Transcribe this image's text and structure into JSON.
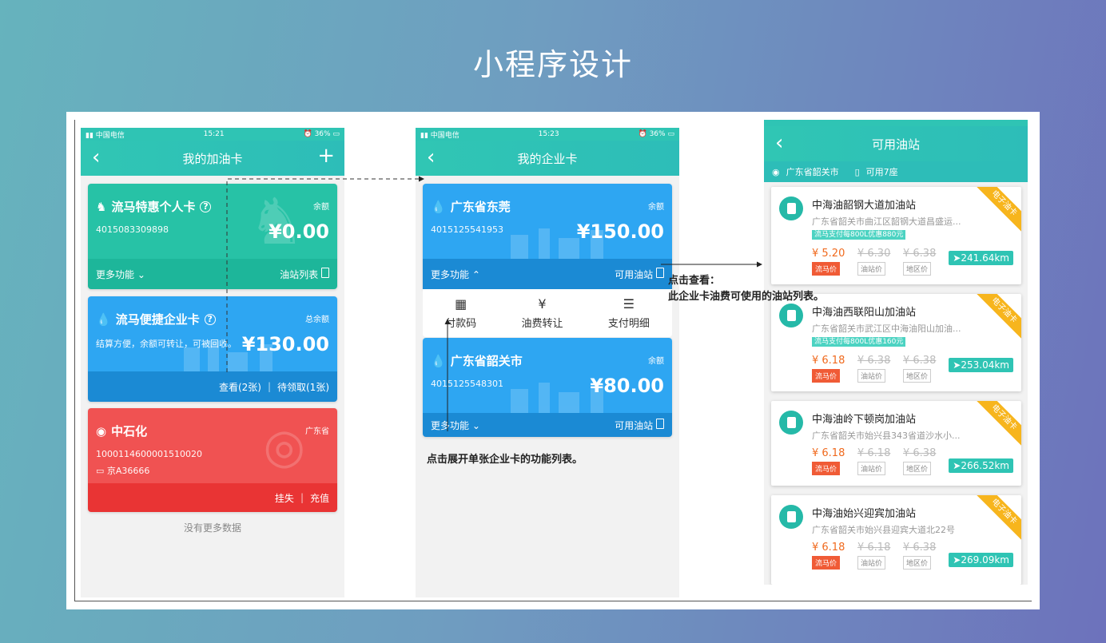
{
  "hero": {
    "title": "小程序设计"
  },
  "screen1": {
    "status": {
      "carrier": "中国电信",
      "time": "15:21",
      "battery": "36%"
    },
    "title": "我的加油卡",
    "cards": [
      {
        "name": "流马特惠个人卡",
        "number": "4015083309898",
        "balance_label": "余额",
        "balance": "¥0.00",
        "left": "更多功能",
        "right": "油站列表"
      },
      {
        "name": "流马便捷企业卡",
        "subtitle": "结算方便，余额可转让，可被回收。",
        "balance_label": "总余额",
        "balance": "¥130.00",
        "link1": "查看(2张)",
        "link2": "待领取(1张)"
      },
      {
        "name": "中石化",
        "number": "1000114600001510020",
        "plate": "京A36666",
        "region": "广东省",
        "action1": "挂失",
        "action2": "充值"
      }
    ],
    "footer": "没有更多数据"
  },
  "screen2": {
    "status": {
      "carrier": "中国电信",
      "time": "15:23",
      "battery": "36%"
    },
    "title": "我的企业卡",
    "cards": [
      {
        "name": "广东省东莞",
        "number": "4015125541953",
        "balance_label": "余额",
        "balance": "¥150.00",
        "left": "更多功能",
        "right": "可用油站"
      },
      {
        "name": "广东省韶关市",
        "number": "4015125548301",
        "balance_label": "余额",
        "balance": "¥80.00",
        "left": "更多功能",
        "right": "可用油站"
      }
    ],
    "menu": [
      "付款码",
      "油费转让",
      "支付明细"
    ],
    "note": "点击展开单张企业卡的功能列表。"
  },
  "screen3": {
    "title": "可用油站",
    "location": "广东省韶关市",
    "seats": "可用7座",
    "stations": [
      {
        "name": "中海油韶钢大道加油站",
        "address": "广东省韶关市曲江区韶钢大道昌盛运...",
        "promo": "流马支付每800L优惠880元",
        "p1": "¥ 5.20",
        "p2": "¥ 6.30",
        "p3": "¥ 6.38",
        "distance": "241.64km"
      },
      {
        "name": "中海油西联阳山加油站",
        "address": "广东省韶关市武江区中海油阳山加油...",
        "promo": "流马支付每800L优惠160元",
        "p1": "¥ 6.18",
        "p2": "¥ 6.38",
        "p3": "¥ 6.38",
        "distance": "253.04km"
      },
      {
        "name": "中海油岭下顿岗加油站",
        "address": "广东省韶关市始兴县343省道沙水小...",
        "promo": "",
        "p1": "¥ 6.18",
        "p2": "¥ 6.18",
        "p3": "¥ 6.38",
        "distance": "266.52km"
      },
      {
        "name": "中海油始兴迎宾加油站",
        "address": "广东省韶关市始兴县迎宾大道北22号",
        "promo": "",
        "p1": "¥ 6.18",
        "p2": "¥ 6.18",
        "p3": "¥ 6.38",
        "distance": "269.09km"
      }
    ],
    "price_tags": [
      "流马价",
      "油站价",
      "地区价"
    ],
    "ribbon": "电子油卡"
  },
  "annotation": {
    "line1": "点击查看：",
    "line2": "此企业卡油费可使用的油站列表。"
  }
}
